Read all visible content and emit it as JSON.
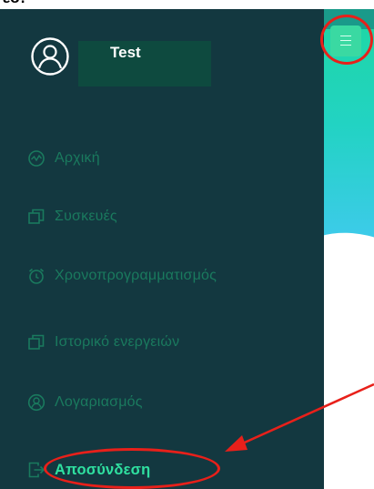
{
  "caption": "εσ.",
  "profile": {
    "name": "Test"
  },
  "menu": [
    {
      "id": "home",
      "label": "Αρχική",
      "icon": "pulse-icon"
    },
    {
      "id": "devices",
      "label": "Συσκευές",
      "icon": "copy-icon"
    },
    {
      "id": "schedule",
      "label": "Χρονοπρογραμματισμός",
      "icon": "alarm-clock-icon"
    },
    {
      "id": "history",
      "label": "Ιστορικό ενεργειών",
      "icon": "copy-icon"
    },
    {
      "id": "account",
      "label": "Λογαριασμός",
      "icon": "user-icon"
    },
    {
      "id": "logout",
      "label": "Αποσύνδεση",
      "icon": "sign-out-icon"
    }
  ],
  "colors": {
    "sidebar_bg": "#133840",
    "menu_text": "#1a7a5e",
    "active_text": "#2fe0a0",
    "annotation": "#e8201a",
    "menu_button": "#3ad9a2"
  }
}
